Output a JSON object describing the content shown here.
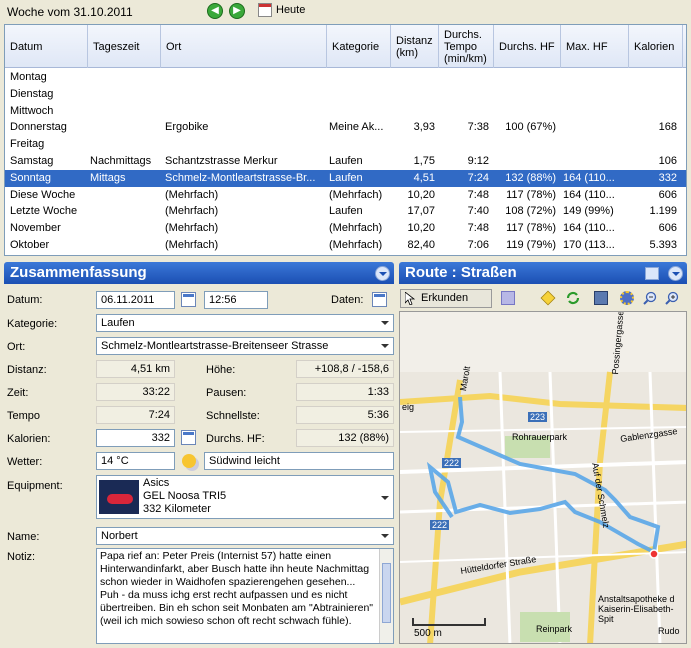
{
  "header": {
    "week_title": "Woche vom 31.10.2011",
    "prev_icon": "arrow-left-icon",
    "next_icon": "arrow-right-icon",
    "today_label": "Heute"
  },
  "table": {
    "columns": [
      "Datum",
      "Tageszeit",
      "Ort",
      "Kategorie",
      "Distanz\n(km)",
      "Durchs.\nTempo\n(min/km)",
      "Durchs. HF",
      "Max. HF",
      "Kalorien"
    ],
    "rows": [
      [
        "Montag",
        "",
        "",
        "",
        "",
        "",
        "",
        "",
        ""
      ],
      [
        "Dienstag",
        "",
        "",
        "",
        "",
        "",
        "",
        "",
        ""
      ],
      [
        "Mittwoch",
        "",
        "",
        "",
        "",
        "",
        "",
        "",
        ""
      ],
      [
        "Donnerstag",
        "",
        "Ergobike",
        "Meine Ak...",
        "3,93",
        "7:38",
        "100 (67%)",
        "",
        "168"
      ],
      [
        "Freitag",
        "",
        "",
        "",
        "",
        "",
        "",
        "",
        ""
      ],
      [
        "Samstag",
        "Nachmittags",
        "Schantzstrasse Merkur",
        "Laufen",
        "1,75",
        "9:12",
        "",
        "",
        "106"
      ],
      [
        "Sonntag",
        "Mittags",
        "Schmelz-Montleartstrasse-Br...",
        "Laufen",
        "4,51",
        "7:24",
        "132 (88%)",
        "164 (110...",
        "332"
      ],
      [
        "Diese Woche",
        "",
        "(Mehrfach)",
        "(Mehrfach)",
        "10,20",
        "7:48",
        "117 (78%)",
        "164 (110...",
        "606"
      ],
      [
        "Letzte Woche",
        "",
        "(Mehrfach)",
        "Laufen",
        "17,07",
        "7:40",
        "108 (72%)",
        "149 (99%)",
        "1.199"
      ],
      [
        "November",
        "",
        "(Mehrfach)",
        "(Mehrfach)",
        "10,20",
        "7:48",
        "117 (78%)",
        "164 (110...",
        "606"
      ],
      [
        "Oktober",
        "",
        "(Mehrfach)",
        "(Mehrfach)",
        "82,40",
        "7:06",
        "119 (79%)",
        "170 (113...",
        "5.393"
      ]
    ],
    "selected_index": 6
  },
  "summary": {
    "title": "Zusammenfassung",
    "datum_label": "Datum:",
    "datum_value": "06.11.2011",
    "time_value": "12:56",
    "daten_label": "Daten:",
    "kategorie_label": "Kategorie:",
    "kategorie_value": "Laufen",
    "ort_label": "Ort:",
    "ort_value": "Schmelz-Montleartstrasse-Breitenseer Strasse",
    "distanz_label": "Distanz:",
    "distanz_value": "4,51 km",
    "hoehe_label": "Höhe:",
    "hoehe_value": "+108,8 / -158,6",
    "zeit_label": "Zeit:",
    "zeit_value": "33:22",
    "pausen_label": "Pausen:",
    "pausen_value": "1:33",
    "tempo_label": "Tempo",
    "tempo_value": "7:24",
    "schnellste_label": "Schnellste:",
    "schnellste_value": "5:36",
    "kalorien_label": "Kalorien:",
    "kalorien_value": "332",
    "hf_label": "Durchs. HF:",
    "hf_value": "132 (88%)",
    "wetter_label": "Wetter:",
    "wetter_temp": "14 °C",
    "wetter_text": "Südwind leicht",
    "equipment_label": "Equipment:",
    "equipment_line1": "Asics",
    "equipment_line2": "GEL Noosa TRI5",
    "equipment_line3": "332 Kilometer",
    "name_label": "Name:",
    "name_value": "Norbert",
    "notiz_label": "Notiz:",
    "notiz_lines": [
      "Papa rief an: Peter Preis (Internist 57) hatte einen",
      "Hinterwandinfarkt, aber Busch hatte ihn heute Nachmittag",
      "schon wieder in Waidhofen spazierengehen gesehen...",
      "Puh - da muss ichg erst recht aufpassen und es nicht",
      "übertreiben. Bin eh schon seit Monbaten am \"Abtrainieren\"",
      "(weil ich mich sowieso schon oft recht schwach fühle)."
    ]
  },
  "route": {
    "title": "Route : Straßen",
    "erkunden_label": "Erkunden",
    "map_labels": {
      "marolt": "Marolt",
      "eig": "eig",
      "poss": "Possingergasse",
      "rohrauer": "Rohrauerpark",
      "gablenz": "Gablenzgasse",
      "schmelz": "Auf der Schmelz",
      "huett": "Hütteldorfer Straße",
      "apo1": "Anstaltsapotheke d",
      "apo2": "Kaiserin-Elisabeth-Spit",
      "reinpark": "Reinpark",
      "rudo": "Rudo",
      "r223": "223",
      "r222a": "222",
      "r222b": "222",
      "scale": "500 m"
    }
  }
}
